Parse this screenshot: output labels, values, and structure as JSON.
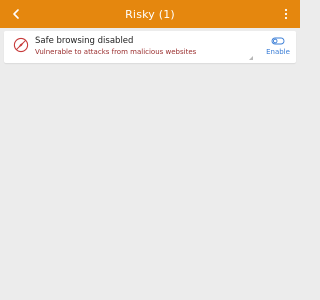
{
  "header": {
    "title": "Risky (1)",
    "back_icon": "chevron-left-icon",
    "menu_icon": "more-vertical-icon",
    "color": "#e5870e"
  },
  "items": [
    {
      "title": "Safe browsing disabled",
      "description": "Vulnerable to attacks from malicious websites",
      "icon": "safari-compass-icon",
      "action_label": "Enable",
      "action_icon": "toggle-off-icon",
      "description_color": "#9a2e2e",
      "action_color": "#3a7dd6"
    }
  ]
}
